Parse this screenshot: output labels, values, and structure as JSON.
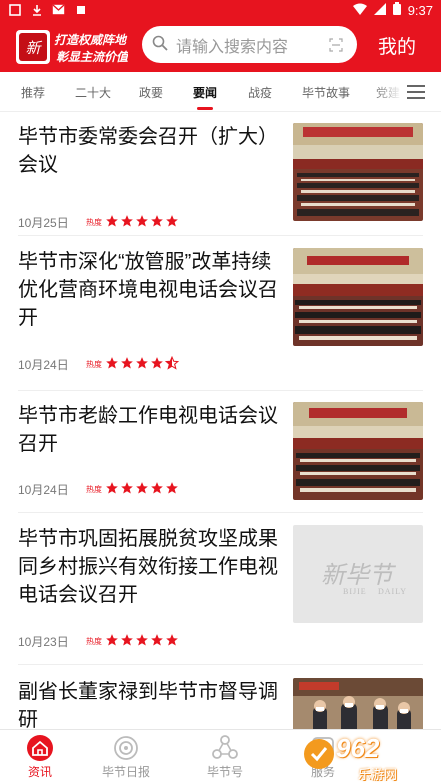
{
  "status_bar": {
    "time": "9:37"
  },
  "header": {
    "logo_text_main": "新毕节",
    "logo_slogan_line1": "打造权威阵地",
    "logo_slogan_line2": "彰显主流价值",
    "search_placeholder": "请输入搜索内容",
    "mine_label": "我的"
  },
  "tabs": [
    {
      "label": "推荐",
      "active": false
    },
    {
      "label": "二十大",
      "active": false
    },
    {
      "label": "政要",
      "active": false
    },
    {
      "label": "要闻",
      "active": true
    },
    {
      "label": "战疫",
      "active": false
    },
    {
      "label": "毕节故事",
      "active": false
    },
    {
      "label": "党建",
      "active": false
    }
  ],
  "news": [
    {
      "title": "毕节市委常委会召开（扩大）会议",
      "date": "10月25日",
      "heat_label": "热度",
      "stars": 5,
      "thumb": "meeting"
    },
    {
      "title": "毕节市深化“放管服”改革持续优化营商环境电视电话会议召开",
      "date": "10月24日",
      "heat_label": "热度",
      "stars": 4.5,
      "thumb": "meeting"
    },
    {
      "title": "毕节市老龄工作电视电话会议召开",
      "date": "10月24日",
      "heat_label": "热度",
      "stars": 5,
      "thumb": "meeting"
    },
    {
      "title": "毕节市巩固拓展脱贫攻坚成果同乡村振兴有效衔接工作电视电话会议召开",
      "date": "10月23日",
      "heat_label": "热度",
      "stars": 5,
      "thumb": "placeholder",
      "placeholder_brand": "新毕节",
      "placeholder_en1": "BIJIE",
      "placeholder_en2": "DAILY"
    },
    {
      "title": "副省长董家禄到毕节市督导调研",
      "date": "",
      "heat_label": "",
      "stars": 0,
      "thumb": "people"
    }
  ],
  "bottom_nav": [
    {
      "label": "资讯",
      "icon": "home-icon",
      "active": true
    },
    {
      "label": "毕节日报",
      "icon": "newspaper-icon",
      "active": false
    },
    {
      "label": "毕节号",
      "icon": "nodes-icon",
      "active": false
    },
    {
      "label": "服务",
      "icon": "service-icon",
      "active": false
    }
  ],
  "watermark": {
    "text": "962",
    "sub": "乐游网"
  },
  "colors": {
    "brand_red": "#e7141f",
    "text": "#111111",
    "muted": "#777777"
  }
}
